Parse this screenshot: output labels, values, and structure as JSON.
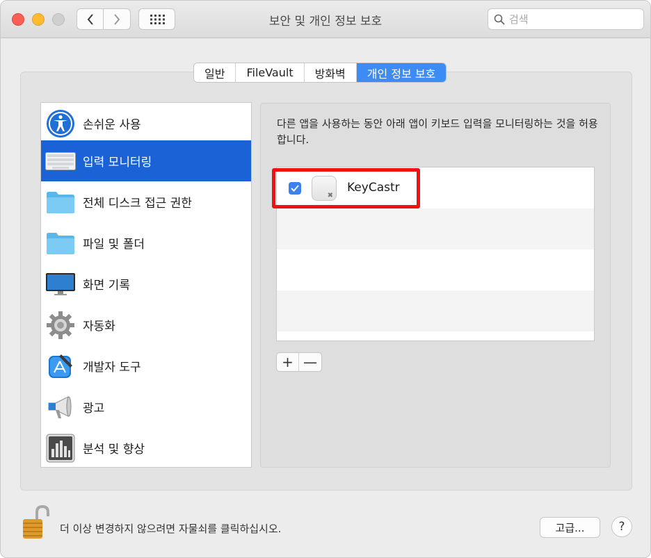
{
  "window": {
    "title": "보안 및 개인 정보 보호"
  },
  "search": {
    "placeholder": "검색"
  },
  "tabs": [
    {
      "label": "일반",
      "active": false
    },
    {
      "label": "FileVault",
      "active": false
    },
    {
      "label": "방화벽",
      "active": false
    },
    {
      "label": "개인 정보 보호",
      "active": true
    }
  ],
  "sidebar": {
    "items": [
      {
        "label": "손쉬운 사용",
        "icon": "accessibility-icon"
      },
      {
        "label": "입력 모니터링",
        "icon": "keyboard-icon",
        "selected": true
      },
      {
        "label": "전체 디스크 접근 권한",
        "icon": "folder-icon"
      },
      {
        "label": "파일 및 폴더",
        "icon": "folder-icon"
      },
      {
        "label": "화면 기록",
        "icon": "display-icon"
      },
      {
        "label": "자동화",
        "icon": "gear-icon"
      },
      {
        "label": "개발자 도구",
        "icon": "developer-tools-icon"
      },
      {
        "label": "광고",
        "icon": "megaphone-icon"
      },
      {
        "label": "분석 및 향상",
        "icon": "analytics-icon"
      }
    ]
  },
  "main": {
    "description": "다른 앱을 사용하는 동안 아래 앱이 키보드 입력을 모니터링하는 것을 허용합니다.",
    "apps": [
      {
        "name": "KeyCastr",
        "checked": true
      }
    ],
    "add_label": "+",
    "remove_label": "—"
  },
  "footer": {
    "lock_text": "더 이상 변경하지 않으려면 자물쇠를 클릭하십시오.",
    "advanced_label": "고급...",
    "help_label": "?"
  },
  "colors": {
    "accent": "#3d8cf5",
    "selection": "#1a62d6",
    "highlight": "#ee1212"
  }
}
